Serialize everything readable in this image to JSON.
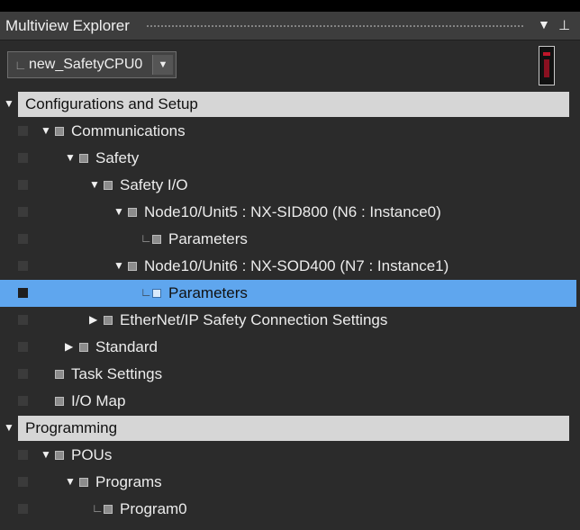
{
  "window": {
    "title": "Multiview Explorer",
    "pin_icon": "pin-icon",
    "menu_icon": "dropdown-icon"
  },
  "selector": {
    "value": "new_SafetyCPU0"
  },
  "sections": {
    "config": "Configurations and Setup",
    "programming": "Programming"
  },
  "tree": {
    "communications": "Communications",
    "safety": "Safety",
    "safety_io": "Safety I/O",
    "node5": "Node10/Unit5 : NX-SID800 (N6 : Instance0)",
    "node5_params": "Parameters",
    "node6": "Node10/Unit6 : NX-SOD400 (N7 : Instance1)",
    "node6_params": "Parameters",
    "ethernet": "EtherNet/IP Safety Connection Settings",
    "standard": "Standard",
    "task_settings": "Task Settings",
    "io_map": "I/O Map",
    "pous": "POUs",
    "programs": "Programs",
    "program0": "Program0"
  },
  "colors": {
    "selection": "#5fa6ee",
    "section_bar": "#d6d6d6",
    "background": "#2b2b2b"
  }
}
